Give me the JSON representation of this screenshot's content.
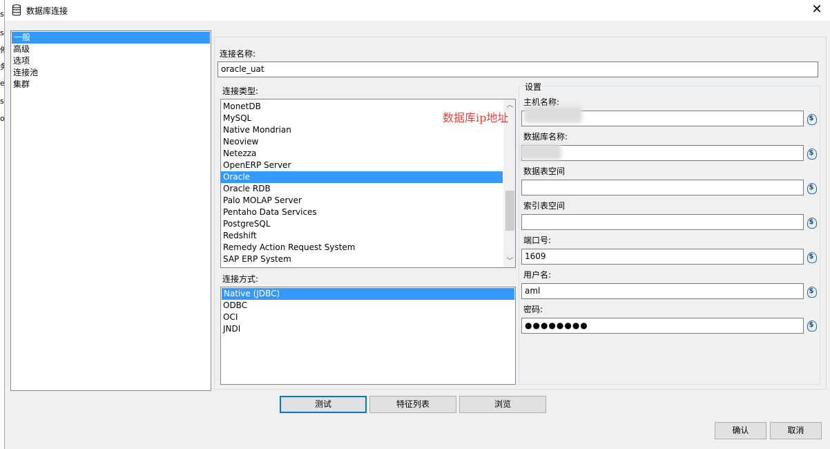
{
  "window": {
    "title": "数据库连接",
    "close_glyph": "✕"
  },
  "background_edge": [
    "s",
    "s",
    "俸",
    "务",
    "e",
    "s",
    "o"
  ],
  "nav": {
    "items": [
      {
        "label": "一般",
        "selected": true
      },
      {
        "label": "高级",
        "selected": false
      },
      {
        "label": "选项",
        "selected": false
      },
      {
        "label": "连接池",
        "selected": false
      },
      {
        "label": "集群",
        "selected": false
      }
    ]
  },
  "connection_name": {
    "label": "连接名称:",
    "value": "oracle_uat"
  },
  "connection_type": {
    "label": "连接类型:",
    "items": [
      "MonetDB",
      "MySQL",
      "Native Mondrian",
      "Neoview",
      "Netezza",
      "OpenERP Server",
      "Oracle",
      "Oracle RDB",
      "Palo MOLAP Server",
      "Pentaho Data Services",
      "PostgreSQL",
      "Redshift",
      "Remedy Action Request System",
      "SAP ERP System"
    ],
    "selected": "Oracle"
  },
  "access_method": {
    "label": "连接方式:",
    "items": [
      "Native (JDBC)",
      "ODBC",
      "OCI",
      "JNDI"
    ],
    "selected": "Native (JDBC)"
  },
  "settings": {
    "title": "设置",
    "host_label": "主机名称:",
    "host_value": "",
    "db_label": "数据库名称:",
    "db_value": "",
    "data_tablespace_label": "数据表空间",
    "data_tablespace_value": "",
    "index_tablespace_label": "索引表空间",
    "index_tablespace_value": "",
    "port_label": "端口号:",
    "port_value": "1609",
    "user_label": "用户名:",
    "user_value": "aml",
    "password_label": "密码:",
    "password_value": "●●●●●●●●",
    "variable_icon_glyph": "$"
  },
  "annotation": "数据库ip地址",
  "buttons": {
    "test": "测试",
    "feature_list": "特征列表",
    "explore": "浏览",
    "ok": "确认",
    "cancel": "取消"
  },
  "colors": {
    "selection": "#3399ff",
    "annotation": "#e8403a",
    "default_button_border": "#0078d7"
  }
}
